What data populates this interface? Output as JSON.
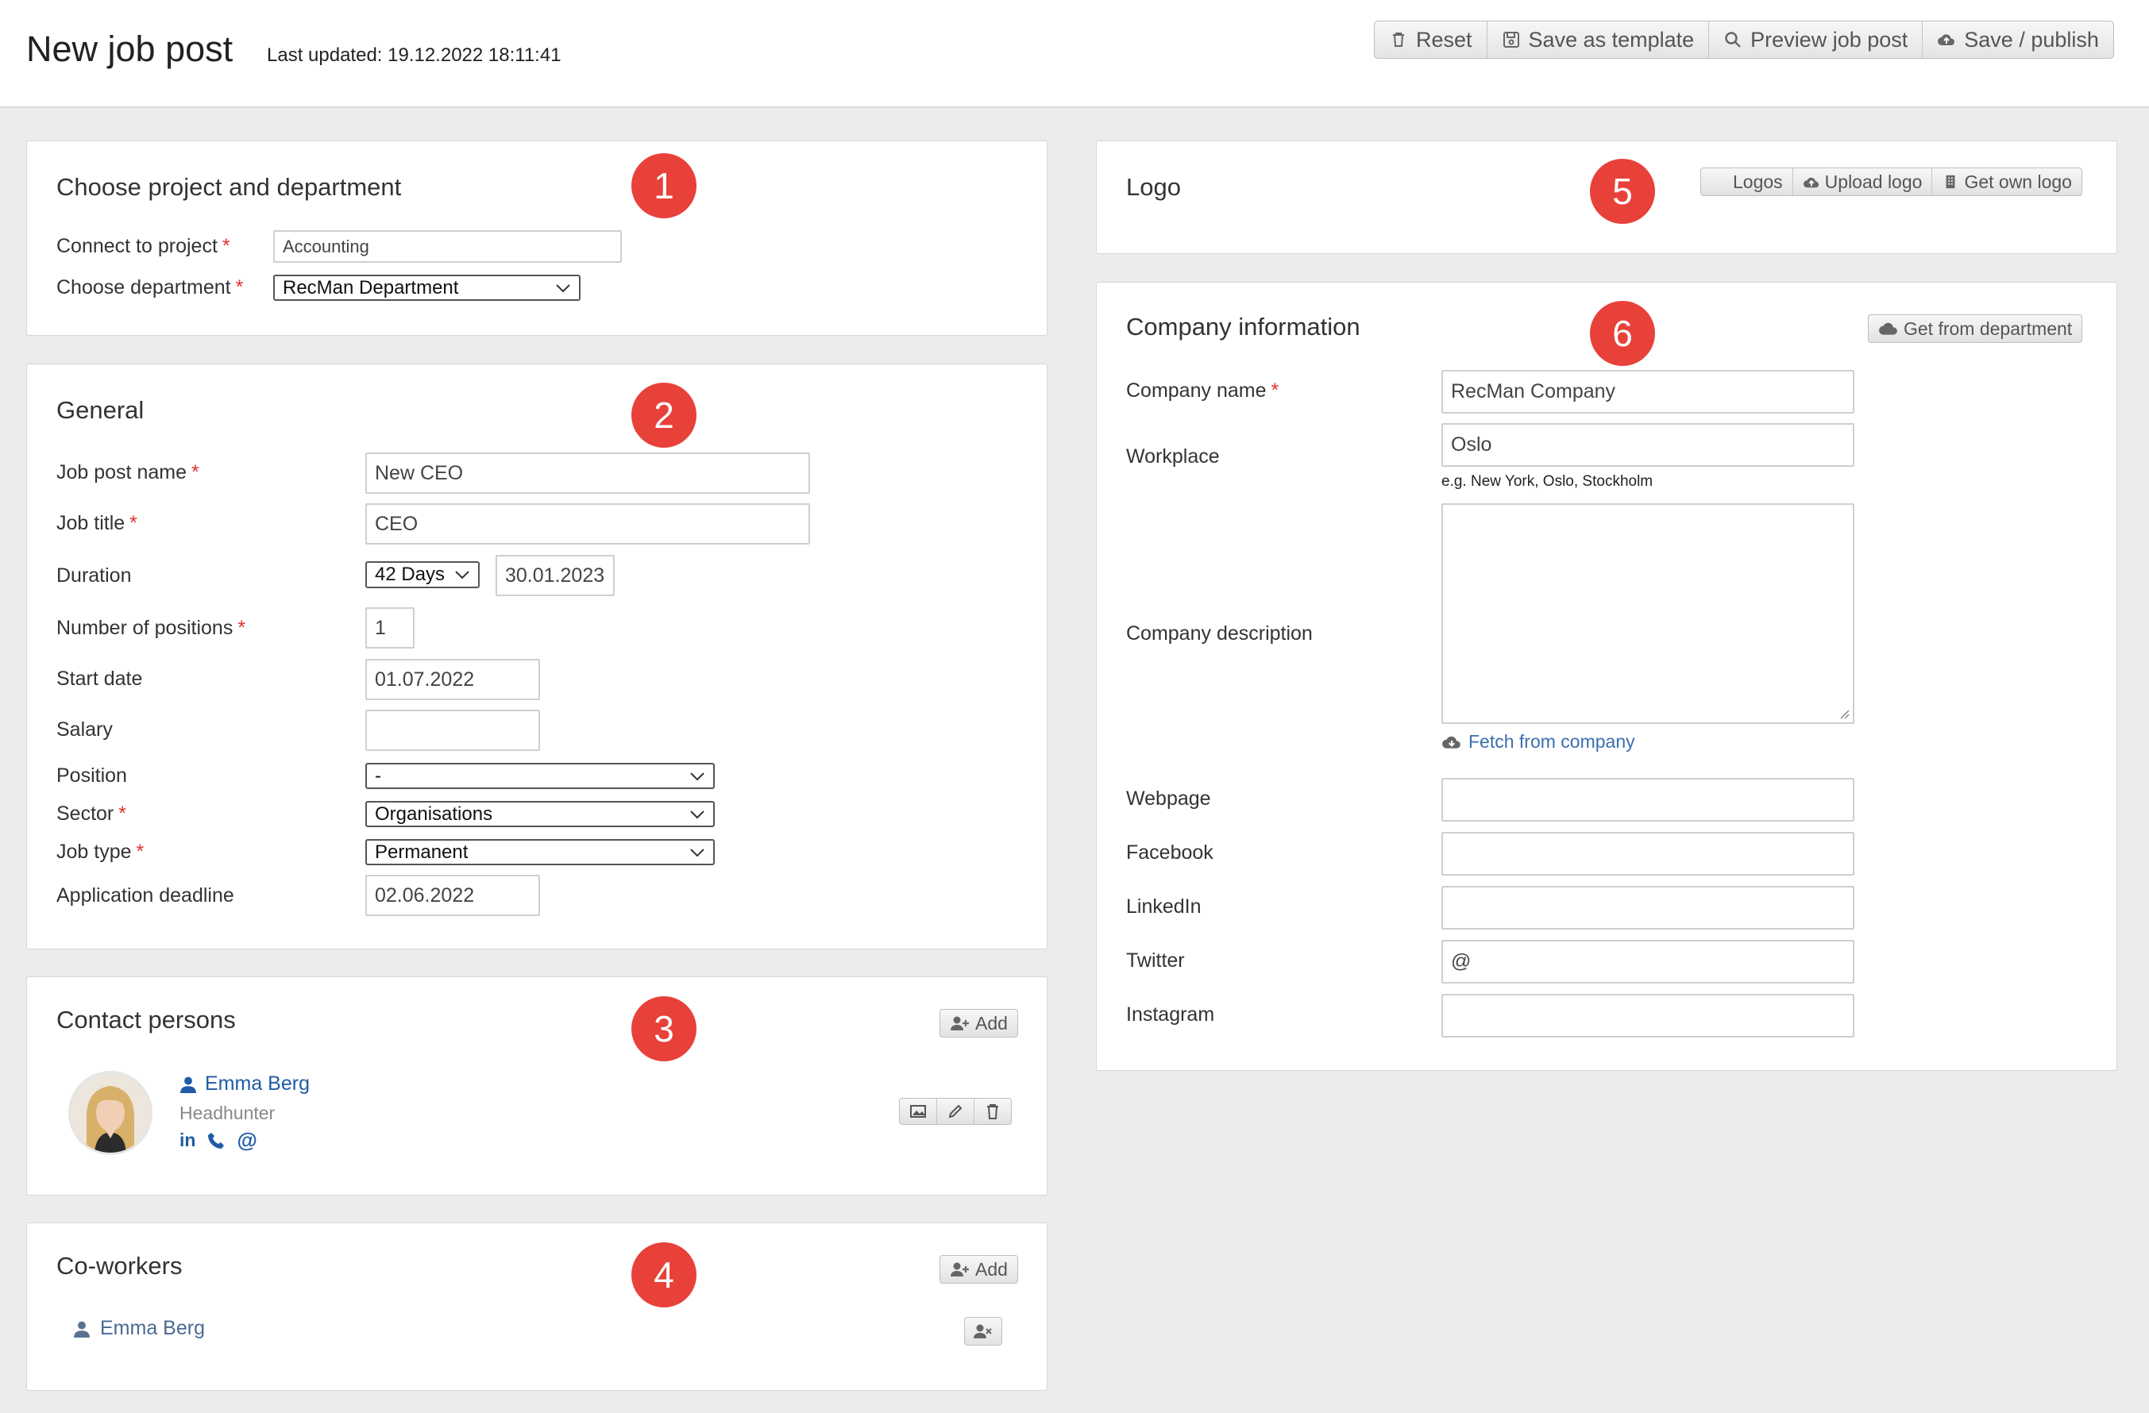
{
  "header": {
    "title": "New job post",
    "last_updated": "Last updated: 19.12.2022 18:11:41",
    "actions": {
      "reset": "Reset",
      "save_template": "Save as template",
      "preview": "Preview job post",
      "publish": "Save / publish"
    }
  },
  "project": {
    "title": "Choose project and department",
    "badge": "1",
    "connect_label": "Connect to project",
    "connect_value": "Accounting",
    "department_label": "Choose department",
    "department_value": "RecMan Department"
  },
  "general": {
    "title": "General",
    "badge": "2",
    "job_post_name_label": "Job post name",
    "job_post_name_value": "New CEO",
    "job_title_label": "Job title",
    "job_title_value": "CEO",
    "duration_label": "Duration",
    "duration_value": "42 Days",
    "duration_date": "30.01.2023",
    "positions_label": "Number of positions",
    "positions_value": "1",
    "start_date_label": "Start date",
    "start_date_value": "01.07.2022",
    "salary_label": "Salary",
    "salary_value": "",
    "position_label": "Position",
    "position_value": "-",
    "sector_label": "Sector",
    "sector_value": "Organisations",
    "job_type_label": "Job type",
    "job_type_value": "Permanent",
    "deadline_label": "Application deadline",
    "deadline_value": "02.06.2022"
  },
  "contacts": {
    "title": "Contact persons",
    "badge": "3",
    "add_label": "Add",
    "person": {
      "name": "Emma Berg",
      "role": "Headhunter"
    }
  },
  "coworkers": {
    "title": "Co-workers",
    "badge": "4",
    "add_label": "Add",
    "person": {
      "name": "Emma Berg"
    }
  },
  "logo": {
    "title": "Logo",
    "badge": "5",
    "logos_label": "Logos",
    "upload_label": "Upload logo",
    "get_own_label": "Get own logo"
  },
  "company": {
    "title": "Company information",
    "badge": "6",
    "get_from_dept": "Get from department",
    "name_label": "Company name",
    "name_value": "RecMan Company",
    "workplace_label": "Workplace",
    "workplace_value": "Oslo",
    "workplace_hint": "e.g. New York, Oslo, Stockholm",
    "description_label": "Company description",
    "fetch_label": "Fetch from company",
    "webpage_label": "Webpage",
    "facebook_label": "Facebook",
    "linkedin_label": "LinkedIn",
    "twitter_label": "Twitter",
    "twitter_value": "@",
    "instagram_label": "Instagram"
  },
  "colors": {
    "badge": "#e8413a",
    "required": "#e0322c",
    "link": "#1f5ba5"
  }
}
